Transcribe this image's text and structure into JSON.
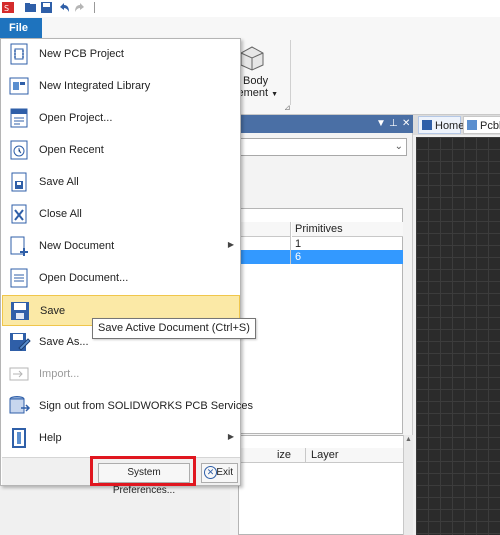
{
  "file_tab": {
    "label": "File"
  },
  "ribbon": {
    "group_label_line1": "D Body",
    "group_label_line2": "cement"
  },
  "doc_tabs": [
    {
      "label": "Home"
    },
    {
      "label": "Pcbl"
    }
  ],
  "grid_top": {
    "columns": [
      "",
      "Primitives"
    ],
    "rows": [
      {
        "primitives": "1",
        "selected": false
      },
      {
        "primitives": "6",
        "selected": true
      }
    ]
  },
  "grid_bottom": {
    "columns": [
      "ize",
      "Layer"
    ]
  },
  "file_menu": {
    "items": [
      {
        "label": "New PCB Project",
        "icon": "new-pcb-project-icon",
        "submenu": false,
        "disabled": false,
        "highlighted": false
      },
      {
        "label": "New Integrated Library",
        "icon": "new-integrated-library-icon",
        "submenu": false,
        "disabled": false,
        "highlighted": false
      },
      {
        "label": "Open Project...",
        "icon": "open-project-icon",
        "submenu": false,
        "disabled": false,
        "highlighted": false
      },
      {
        "label": "Open Recent",
        "icon": "open-recent-icon",
        "submenu": false,
        "disabled": false,
        "highlighted": false
      },
      {
        "label": "Save All",
        "icon": "save-all-icon",
        "submenu": false,
        "disabled": false,
        "highlighted": false
      },
      {
        "label": "Close All",
        "icon": "close-all-icon",
        "submenu": false,
        "disabled": false,
        "highlighted": false
      },
      {
        "label": "New Document",
        "icon": "new-document-icon",
        "submenu": true,
        "disabled": false,
        "highlighted": false
      },
      {
        "label": "Open Document...",
        "icon": "open-document-icon",
        "submenu": false,
        "disabled": false,
        "highlighted": false
      },
      {
        "label": "Save",
        "icon": "save-icon",
        "submenu": false,
        "disabled": false,
        "highlighted": true
      },
      {
        "label": "Save As...",
        "icon": "save-as-icon",
        "submenu": false,
        "disabled": false,
        "highlighted": false
      },
      {
        "label": "Import...",
        "icon": "import-icon",
        "submenu": false,
        "disabled": true,
        "highlighted": false
      },
      {
        "label": "Sign out from SOLIDWORKS PCB Services",
        "icon": "sign-out-icon",
        "submenu": false,
        "disabled": false,
        "highlighted": false
      },
      {
        "label": "Help",
        "icon": "help-icon",
        "submenu": true,
        "disabled": false,
        "highlighted": false
      }
    ],
    "system_preferences_label": "System Preferences...",
    "exit_label": "Exit"
  },
  "tooltip": {
    "text": "Save Active Document (Ctrl+S)"
  },
  "colors": {
    "file_tab": "#1e73be",
    "highlight_box": "#e0161f",
    "hover": "#fbe9a6",
    "selection": "#3399ff"
  }
}
